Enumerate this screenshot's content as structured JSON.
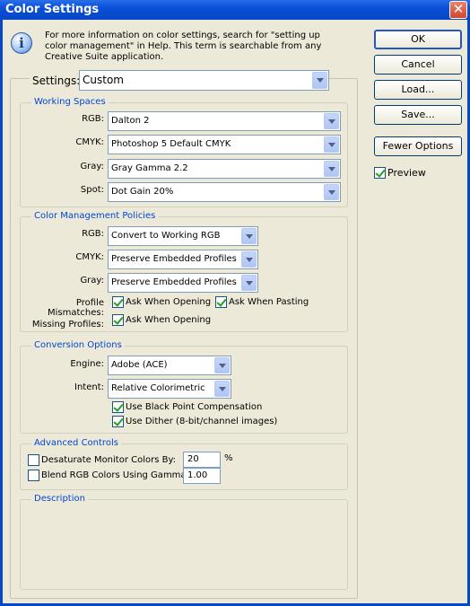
{
  "window": {
    "title": "Color Settings",
    "close_glyph": "✕"
  },
  "info": {
    "icon": "info-icon",
    "icon_glyph": "i",
    "text_line1": "For more information on color settings, search for \"setting up",
    "text_line2": "color management\" in Help. This term is searchable from any",
    "text_line3": "Creative Suite application."
  },
  "settings": {
    "label": "Settings:",
    "value": "Custom"
  },
  "working_spaces": {
    "title": "Working Spaces",
    "rgb_label": "RGB:",
    "rgb_value": "Dalton 2",
    "cmyk_label": "CMYK:",
    "cmyk_value": "Photoshop 5 Default CMYK",
    "gray_label": "Gray:",
    "gray_value": "Gray Gamma 2.2",
    "spot_label": "Spot:",
    "spot_value": "Dot Gain 20%"
  },
  "policies": {
    "title": "Color Management Policies",
    "rgb_label": "RGB:",
    "rgb_value": "Convert to Working RGB",
    "cmyk_label": "CMYK:",
    "cmyk_value": "Preserve Embedded Profiles",
    "gray_label": "Gray:",
    "gray_value": "Preserve Embedded Profiles",
    "mismatch_label": "Profile Mismatches:",
    "ask_opening_label": "Ask When Opening",
    "ask_pasting_label": "Ask When Pasting",
    "missing_label": "Missing Profiles:",
    "missing_ask_opening_label": "Ask When Opening"
  },
  "conversion": {
    "title": "Conversion Options",
    "engine_label": "Engine:",
    "engine_value": "Adobe (ACE)",
    "intent_label": "Intent:",
    "intent_value": "Relative Colorimetric",
    "bpc_label": "Use Black Point Compensation",
    "dither_label": "Use Dither (8-bit/channel images)"
  },
  "advanced": {
    "title": "Advanced Controls",
    "desaturate_label": "Desaturate Monitor Colors By:",
    "desaturate_value": "20",
    "percent": "%",
    "blend_label": "Blend RGB Colors Using Gamma:",
    "blend_value": "1.00"
  },
  "description": {
    "title": "Description"
  },
  "buttons": {
    "ok": "OK",
    "cancel": "Cancel",
    "load": "Load...",
    "save": "Save...",
    "fewer_options": "Fewer Options",
    "preview_label": "Preview"
  },
  "colors": {
    "title_bar": "#0a4fd8",
    "group_title": "#0046d5",
    "dialog_bg": "#ece9d8"
  }
}
